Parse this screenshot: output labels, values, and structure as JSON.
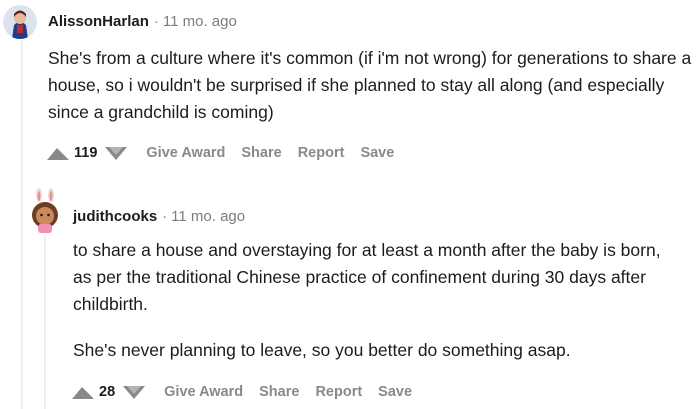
{
  "comments": [
    {
      "username": "AlissonHarlan",
      "separator": "·",
      "age": "11 mo. ago",
      "paragraphs": [
        "She's from a culture where it's common (if i'm not wrong) for generations to share a house, so i wouldn't be surprised if she planned to stay all along (and especially since a grandchild is coming)"
      ],
      "score": "119",
      "actions": {
        "give_award": "Give Award",
        "share": "Share",
        "report": "Report",
        "save": "Save"
      },
      "avatar_icon": "snoo-avatar-icon"
    },
    {
      "username": "judithcooks",
      "separator": "·",
      "age": "11 mo. ago",
      "paragraphs": [
        "to share a house and overstaying for at least a month after the baby is born, as per the traditional Chinese practice of confinement during 30 days after childbirth.",
        "She's never planning to leave, so you better do something asap."
      ],
      "score": "28",
      "actions": {
        "give_award": "Give Award",
        "share": "Share",
        "report": "Report",
        "save": "Save"
      },
      "avatar_icon": "bunny-ears-avatar-icon"
    }
  ],
  "colors": {
    "text": "#1c1c1c",
    "meta": "#7c7c7c",
    "action": "#878a8c",
    "thread_line": "#edeff1",
    "vote_arrow": "#878a8c"
  }
}
